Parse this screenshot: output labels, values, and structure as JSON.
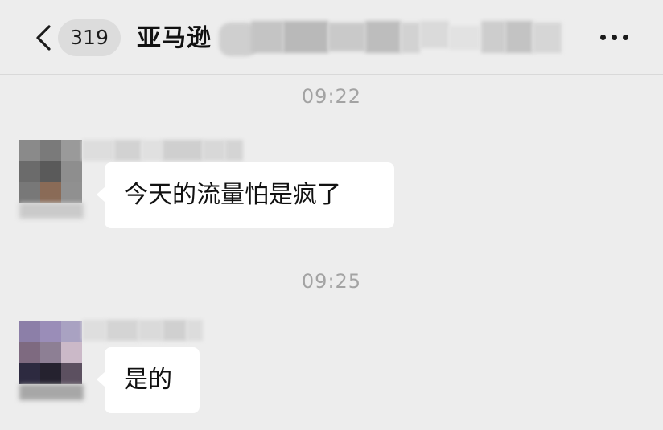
{
  "header": {
    "back_badge": "319",
    "title": "亚马逊",
    "back_icon": "chevron-left-icon",
    "more_icon": "more-horizontal-icon"
  },
  "messages": [
    {
      "time": "09:22",
      "text": "今天的流量怕是疯了"
    },
    {
      "time": "09:25",
      "text": "是的"
    }
  ]
}
